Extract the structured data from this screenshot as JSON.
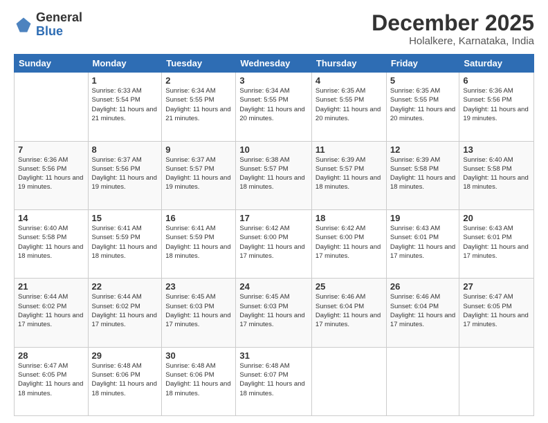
{
  "header": {
    "logo_general": "General",
    "logo_blue": "Blue",
    "month_title": "December 2025",
    "subtitle": "Holalkere, Karnataka, India"
  },
  "days_of_week": [
    "Sunday",
    "Monday",
    "Tuesday",
    "Wednesday",
    "Thursday",
    "Friday",
    "Saturday"
  ],
  "weeks": [
    [
      {
        "day": "",
        "sunrise": "",
        "sunset": "",
        "daylight": ""
      },
      {
        "day": "1",
        "sunrise": "6:33 AM",
        "sunset": "5:54 PM",
        "daylight": "11 hours and 21 minutes."
      },
      {
        "day": "2",
        "sunrise": "6:34 AM",
        "sunset": "5:55 PM",
        "daylight": "11 hours and 21 minutes."
      },
      {
        "day": "3",
        "sunrise": "6:34 AM",
        "sunset": "5:55 PM",
        "daylight": "11 hours and 20 minutes."
      },
      {
        "day": "4",
        "sunrise": "6:35 AM",
        "sunset": "5:55 PM",
        "daylight": "11 hours and 20 minutes."
      },
      {
        "day": "5",
        "sunrise": "6:35 AM",
        "sunset": "5:55 PM",
        "daylight": "11 hours and 20 minutes."
      },
      {
        "day": "6",
        "sunrise": "6:36 AM",
        "sunset": "5:56 PM",
        "daylight": "11 hours and 19 minutes."
      }
    ],
    [
      {
        "day": "7",
        "sunrise": "6:36 AM",
        "sunset": "5:56 PM",
        "daylight": "11 hours and 19 minutes."
      },
      {
        "day": "8",
        "sunrise": "6:37 AM",
        "sunset": "5:56 PM",
        "daylight": "11 hours and 19 minutes."
      },
      {
        "day": "9",
        "sunrise": "6:37 AM",
        "sunset": "5:57 PM",
        "daylight": "11 hours and 19 minutes."
      },
      {
        "day": "10",
        "sunrise": "6:38 AM",
        "sunset": "5:57 PM",
        "daylight": "11 hours and 18 minutes."
      },
      {
        "day": "11",
        "sunrise": "6:39 AM",
        "sunset": "5:57 PM",
        "daylight": "11 hours and 18 minutes."
      },
      {
        "day": "12",
        "sunrise": "6:39 AM",
        "sunset": "5:58 PM",
        "daylight": "11 hours and 18 minutes."
      },
      {
        "day": "13",
        "sunrise": "6:40 AM",
        "sunset": "5:58 PM",
        "daylight": "11 hours and 18 minutes."
      }
    ],
    [
      {
        "day": "14",
        "sunrise": "6:40 AM",
        "sunset": "5:58 PM",
        "daylight": "11 hours and 18 minutes."
      },
      {
        "day": "15",
        "sunrise": "6:41 AM",
        "sunset": "5:59 PM",
        "daylight": "11 hours and 18 minutes."
      },
      {
        "day": "16",
        "sunrise": "6:41 AM",
        "sunset": "5:59 PM",
        "daylight": "11 hours and 18 minutes."
      },
      {
        "day": "17",
        "sunrise": "6:42 AM",
        "sunset": "6:00 PM",
        "daylight": "11 hours and 17 minutes."
      },
      {
        "day": "18",
        "sunrise": "6:42 AM",
        "sunset": "6:00 PM",
        "daylight": "11 hours and 17 minutes."
      },
      {
        "day": "19",
        "sunrise": "6:43 AM",
        "sunset": "6:01 PM",
        "daylight": "11 hours and 17 minutes."
      },
      {
        "day": "20",
        "sunrise": "6:43 AM",
        "sunset": "6:01 PM",
        "daylight": "11 hours and 17 minutes."
      }
    ],
    [
      {
        "day": "21",
        "sunrise": "6:44 AM",
        "sunset": "6:02 PM",
        "daylight": "11 hours and 17 minutes."
      },
      {
        "day": "22",
        "sunrise": "6:44 AM",
        "sunset": "6:02 PM",
        "daylight": "11 hours and 17 minutes."
      },
      {
        "day": "23",
        "sunrise": "6:45 AM",
        "sunset": "6:03 PM",
        "daylight": "11 hours and 17 minutes."
      },
      {
        "day": "24",
        "sunrise": "6:45 AM",
        "sunset": "6:03 PM",
        "daylight": "11 hours and 17 minutes."
      },
      {
        "day": "25",
        "sunrise": "6:46 AM",
        "sunset": "6:04 PM",
        "daylight": "11 hours and 17 minutes."
      },
      {
        "day": "26",
        "sunrise": "6:46 AM",
        "sunset": "6:04 PM",
        "daylight": "11 hours and 17 minutes."
      },
      {
        "day": "27",
        "sunrise": "6:47 AM",
        "sunset": "6:05 PM",
        "daylight": "11 hours and 17 minutes."
      }
    ],
    [
      {
        "day": "28",
        "sunrise": "6:47 AM",
        "sunset": "6:05 PM",
        "daylight": "11 hours and 18 minutes."
      },
      {
        "day": "29",
        "sunrise": "6:48 AM",
        "sunset": "6:06 PM",
        "daylight": "11 hours and 18 minutes."
      },
      {
        "day": "30",
        "sunrise": "6:48 AM",
        "sunset": "6:06 PM",
        "daylight": "11 hours and 18 minutes."
      },
      {
        "day": "31",
        "sunrise": "6:48 AM",
        "sunset": "6:07 PM",
        "daylight": "11 hours and 18 minutes."
      },
      {
        "day": "",
        "sunrise": "",
        "sunset": "",
        "daylight": ""
      },
      {
        "day": "",
        "sunrise": "",
        "sunset": "",
        "daylight": ""
      },
      {
        "day": "",
        "sunrise": "",
        "sunset": "",
        "daylight": ""
      }
    ]
  ]
}
